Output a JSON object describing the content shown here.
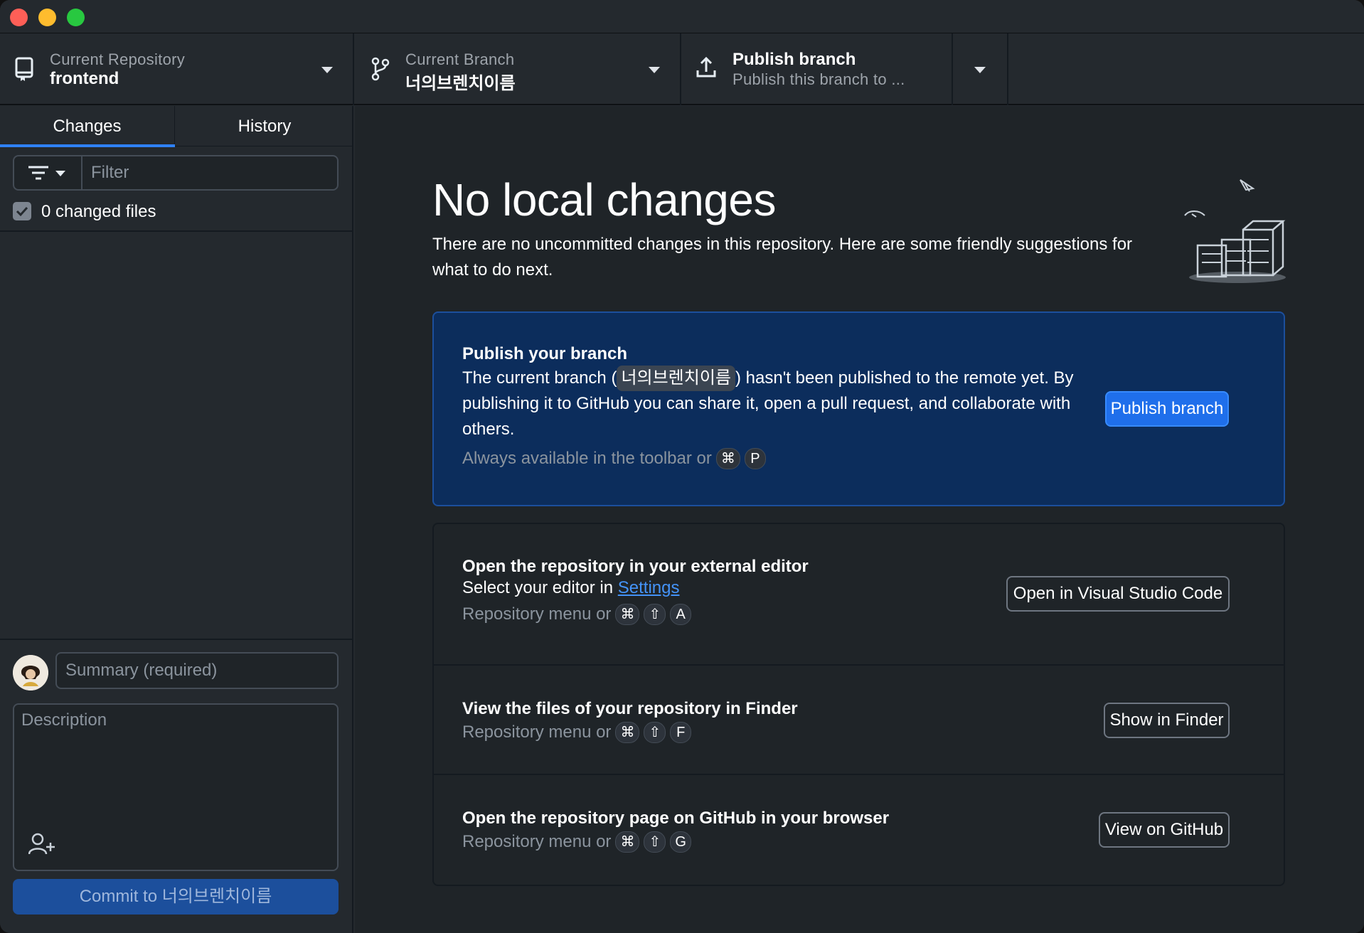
{
  "toolbar": {
    "repository": {
      "label": "Current Repository",
      "value": "frontend"
    },
    "branch": {
      "label": "Current Branch",
      "value": "너의브렌치이름"
    },
    "publish": {
      "label": "Publish branch",
      "sublabel": "Publish this branch to ..."
    }
  },
  "sidebar": {
    "tabs": [
      {
        "label": "Changes"
      },
      {
        "label": "History"
      }
    ],
    "filter_placeholder": "Filter",
    "changed_files_label": "0 changed files",
    "summary_placeholder": "Summary (required)",
    "description_placeholder": "Description",
    "commit_button": "Commit to 너의브렌치이름"
  },
  "main": {
    "title": "No local changes",
    "subtitle": "There are no uncommitted changes in this repository. Here are some friendly suggestions for what to do next.",
    "publish_card": {
      "title": "Publish your branch",
      "text_before": "The current branch (",
      "branch": "너의브렌치이름",
      "text_after": ") hasn't been published to the remote yet. By publishing it to GitHub you can share it, open a pull request, and collaborate with others.",
      "hint": "Always available in the toolbar or",
      "keys": [
        "⌘",
        "P"
      ],
      "button": "Publish branch"
    },
    "editor_card": {
      "title": "Open the repository in your external editor",
      "text": "Select your editor in",
      "link": "Settings",
      "hint": "Repository menu or",
      "keys": [
        "⌘",
        "⇧",
        "A"
      ],
      "button": "Open in Visual Studio Code"
    },
    "finder_card": {
      "title": "View the files of your repository in Finder",
      "hint": "Repository menu or",
      "keys": [
        "⌘",
        "⇧",
        "F"
      ],
      "button": "Show in Finder"
    },
    "github_card": {
      "title": "Open the repository page on GitHub in your browser",
      "hint": "Repository menu or",
      "keys": [
        "⌘",
        "⇧",
        "G"
      ],
      "button": "View on GitHub"
    }
  },
  "colors": {
    "accent": "#1f6feb",
    "publish_card_bg": "#0c2d5c",
    "background": "#1f2428",
    "sidebar_bg": "#24292e"
  }
}
